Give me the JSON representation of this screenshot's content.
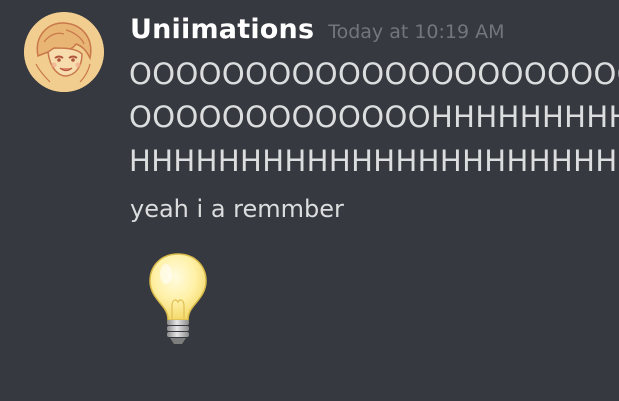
{
  "message": {
    "author": "Uniimations",
    "timestamp": "Today at 10:19 AM",
    "lines": [
      "OOOOOOOOOOOOOOOOOOOOOOOOOO",
      "OOOOOOOOOOOOOHHHHHHHHHHHHHH",
      "HHHHHHHHHHHHHHHHHHHHHHHHHHH"
    ],
    "reply": "yeah i a remmber",
    "emoji": "light-bulb"
  },
  "colors": {
    "background": "#36393f",
    "username": "#ffffff",
    "timestamp": "#72767d",
    "text": "#dcddde"
  }
}
